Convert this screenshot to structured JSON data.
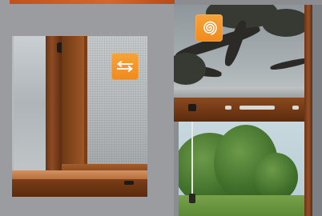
{
  "brand_colors": {
    "accent_orange": "#f39a2a",
    "top_strip": "#c9561f",
    "background": "#9a9ca0",
    "wood": "#8d4c22"
  },
  "photos": [
    {
      "subject": "sliding-screen-window",
      "badge_icon": "sliding-arrows-icon"
    },
    {
      "subject": "roller-screen-window",
      "badge_icon": "spiral-roll-icon"
    }
  ]
}
